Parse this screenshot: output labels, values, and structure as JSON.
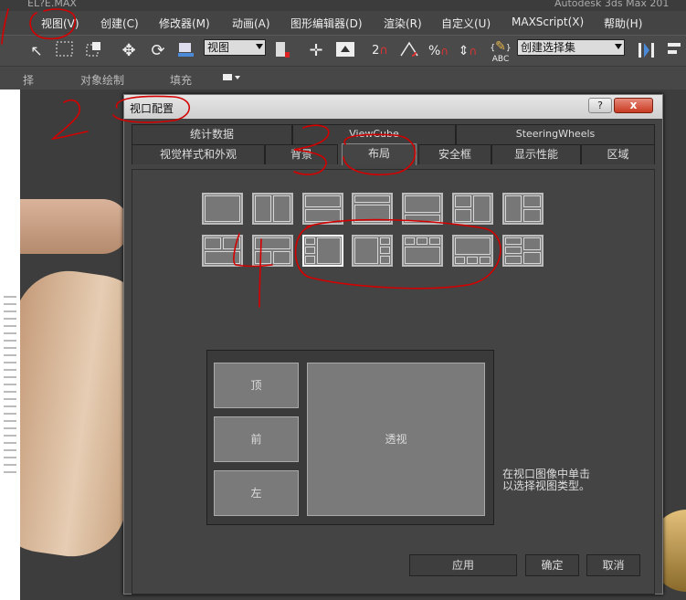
{
  "titlebar": {
    "left": "EL?E.MAX",
    "right": "Autodesk 3ds Max 201"
  },
  "menu": {
    "items": [
      "视图(V)",
      "创建(C)",
      "修改器(M)",
      "动画(A)",
      "图形编辑器(D)",
      "渲染(R)",
      "自定义(U)",
      "MAXScript(X)",
      "帮助(H)"
    ]
  },
  "toolbar": {
    "view_combo": "视图",
    "selection_set_combo": "创建选择集",
    "spinner_label": "2",
    "percent_label": "%",
    "abc_label": "ABC"
  },
  "ribbon": {
    "items": [
      "择",
      "对象绘制",
      "填充"
    ]
  },
  "dialog": {
    "title": "视口配置",
    "help": "?",
    "close": "x",
    "tabs_row1": [
      "统计数据",
      "ViewCube",
      "SteeringWheels"
    ],
    "tabs_row2": [
      "视觉样式和外观",
      "背景",
      "布局",
      "安全框",
      "显示性能",
      "区域"
    ],
    "active_tab": "布局",
    "preview": {
      "top": "顶",
      "front": "前",
      "left": "左",
      "perspective": "透视"
    },
    "hint_line1": "在视口图像中单击",
    "hint_line2": "以选择视图类型。",
    "buttons": {
      "apply": "应用",
      "ok": "确定",
      "cancel": "取消"
    }
  },
  "annotations": {
    "one": "1",
    "two": "2",
    "three": "3",
    "four": "4"
  },
  "colors": {
    "annotation": "#d40000",
    "dialog_bg": "#444444",
    "viewport_bg": "#3d3d3d"
  }
}
